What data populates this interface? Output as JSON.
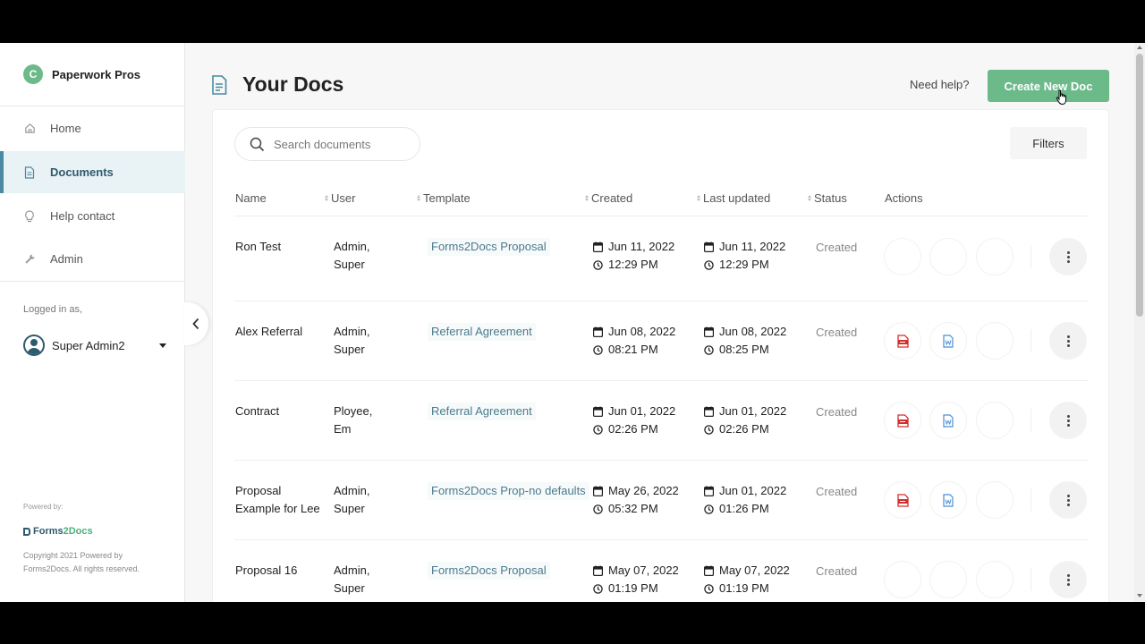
{
  "app": {
    "name": "Paperwork Pros",
    "logo_letter": "C",
    "accent": "#6cb98a",
    "nav_active": "#4a8aa2"
  },
  "sidebar": {
    "items": [
      {
        "label": "Home",
        "icon": "home-icon"
      },
      {
        "label": "Documents",
        "icon": "document-icon"
      },
      {
        "label": "Help contact",
        "icon": "lightbulb-icon"
      },
      {
        "label": "Admin",
        "icon": "wrench-icon"
      }
    ],
    "logged_in_label": "Logged in as,",
    "user_name": "Super Admin2",
    "powered_by": "Powered by:",
    "powered_logo_a": "Forms",
    "powered_logo_b": "2Docs",
    "copyright": "Copyright 2021 Powered by Forms2Docs. All rights reserved."
  },
  "header": {
    "title": "Your Docs",
    "help": "Need help?",
    "create_button": "Create New Doc"
  },
  "toolbar": {
    "search_placeholder": "Search documents",
    "filters": "Filters"
  },
  "table": {
    "columns": [
      "Name",
      "User",
      "Template",
      "Created",
      "Last updated",
      "Status",
      "Actions"
    ],
    "rows": [
      {
        "name_l1": "Ron Test",
        "name_l2": "",
        "user_l1": "Admin,",
        "user_l2": "Super",
        "template": "Forms2Docs Proposal",
        "created_date": "Jun 11, 2022",
        "created_time": "12:29 PM",
        "updated_date": "Jun 11, 2022",
        "updated_time": "12:29 PM",
        "status": "Created",
        "has_files": false
      },
      {
        "name_l1": "Alex Referral",
        "name_l2": "",
        "user_l1": "Admin,",
        "user_l2": "Super",
        "template": "Referral Agreement",
        "created_date": "Jun 08, 2022",
        "created_time": "08:21 PM",
        "updated_date": "Jun 08, 2022",
        "updated_time": "08:25 PM",
        "status": "Created",
        "has_files": true
      },
      {
        "name_l1": "Contract",
        "name_l2": "",
        "user_l1": "Ployee,",
        "user_l2": "Em",
        "template": "Referral Agreement",
        "created_date": "Jun 01, 2022",
        "created_time": "02:26 PM",
        "updated_date": "Jun 01, 2022",
        "updated_time": "02:26 PM",
        "status": "Created",
        "has_files": true
      },
      {
        "name_l1": "Proposal",
        "name_l2": "Example for Lee",
        "user_l1": "Admin,",
        "user_l2": "Super",
        "template": "Forms2Docs Prop-no defaults",
        "created_date": "May 26, 2022",
        "created_time": "05:32 PM",
        "updated_date": "Jun 01, 2022",
        "updated_time": "01:26 PM",
        "status": "Created",
        "has_files": true
      },
      {
        "name_l1": "Proposal 16",
        "name_l2": "",
        "user_l1": "Admin,",
        "user_l2": "Super",
        "template": "Forms2Docs Proposal",
        "created_date": "May 07, 2022",
        "created_time": "01:19 PM",
        "updated_date": "May 07, 2022",
        "updated_time": "01:19 PM",
        "status": "Created",
        "has_files": false
      }
    ]
  }
}
